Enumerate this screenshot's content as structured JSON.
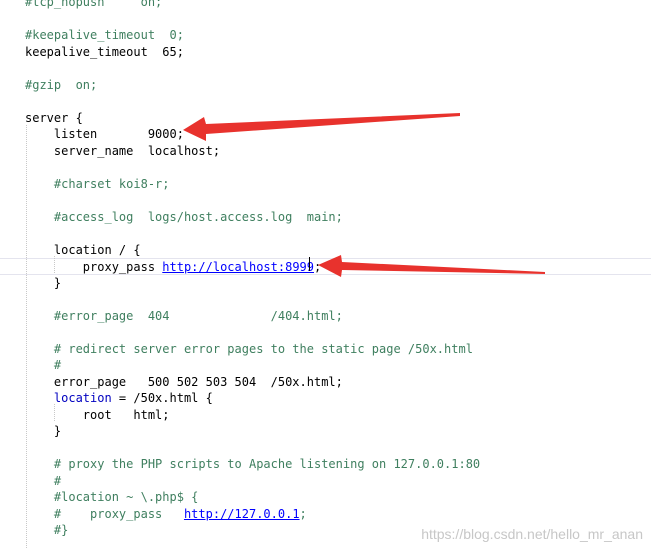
{
  "editor": {
    "lines": [
      {
        "parts": [
          {
            "text": "#tcp_nopush     on;",
            "cls": "comment"
          }
        ]
      },
      {
        "parts": []
      },
      {
        "parts": [
          {
            "text": "#keepalive_timeout  0;",
            "cls": "comment"
          }
        ]
      },
      {
        "parts": [
          {
            "text": "keepalive_timeout  65;",
            "cls": "plain"
          }
        ]
      },
      {
        "parts": []
      },
      {
        "parts": [
          {
            "text": "#gzip  on;",
            "cls": "comment"
          }
        ]
      },
      {
        "parts": []
      },
      {
        "parts": [
          {
            "text": "server {",
            "cls": "plain"
          }
        ]
      },
      {
        "parts": [
          {
            "text": "    listen       9000;",
            "cls": "plain"
          }
        ]
      },
      {
        "parts": [
          {
            "text": "    server_name  localhost;",
            "cls": "plain"
          }
        ]
      },
      {
        "parts": []
      },
      {
        "parts": [
          {
            "text": "    #charset koi8-r;",
            "cls": "comment"
          }
        ]
      },
      {
        "parts": []
      },
      {
        "parts": [
          {
            "text": "    #access_log  logs/host.access.log  main;",
            "cls": "comment"
          }
        ]
      },
      {
        "parts": []
      },
      {
        "parts": [
          {
            "text": "    location / {",
            "cls": "plain"
          }
        ]
      },
      {
        "parts": [
          {
            "text": "        proxy_pass ",
            "cls": "plain"
          },
          {
            "text": "http://localhost:8999",
            "cls": "url"
          },
          {
            "text": ";",
            "cls": "plain"
          }
        ]
      },
      {
        "parts": [
          {
            "text": "    }",
            "cls": "plain"
          }
        ]
      },
      {
        "parts": []
      },
      {
        "parts": [
          {
            "text": "    #error_page  404              /404.html;",
            "cls": "comment"
          }
        ]
      },
      {
        "parts": []
      },
      {
        "parts": [
          {
            "text": "    # redirect server error pages to the static page /50x.html",
            "cls": "comment"
          }
        ]
      },
      {
        "parts": [
          {
            "text": "    #",
            "cls": "comment"
          }
        ]
      },
      {
        "parts": [
          {
            "text": "    error_page   500 502 503 504  /50x.html;",
            "cls": "plain"
          }
        ]
      },
      {
        "parts": [
          {
            "text": "    ",
            "cls": "plain"
          },
          {
            "text": "location",
            "cls": "kw"
          },
          {
            "text": " = /50x.html {",
            "cls": "plain"
          }
        ]
      },
      {
        "parts": [
          {
            "text": "        root   html;",
            "cls": "plain"
          }
        ]
      },
      {
        "parts": [
          {
            "text": "    }",
            "cls": "plain"
          }
        ]
      },
      {
        "parts": []
      },
      {
        "parts": [
          {
            "text": "    # proxy the PHP scripts to Apache listening on 127.0.0.1:80",
            "cls": "comment"
          }
        ]
      },
      {
        "parts": [
          {
            "text": "    #",
            "cls": "comment"
          }
        ]
      },
      {
        "parts": [
          {
            "text": "    #location ~ \\.php$ {",
            "cls": "comment"
          }
        ]
      },
      {
        "parts": [
          {
            "text": "    #    proxy_pass   ",
            "cls": "comment"
          },
          {
            "text": "http://127.0.0.1",
            "cls": "url"
          },
          {
            "text": ";",
            "cls": "comment"
          }
        ]
      },
      {
        "parts": [
          {
            "text": "    #}",
            "cls": "comment"
          }
        ]
      }
    ],
    "current_line_index": 16
  },
  "watermark": "https://blog.csdn.net/hello_mr_anan",
  "colors": {
    "comment": "#3f7f5f",
    "keyword": "#0000c0",
    "link": "#0000ff",
    "arrow": "#e8322d",
    "watermark": "#c7c7c7"
  },
  "icons": [
    "red-arrow-icon"
  ]
}
